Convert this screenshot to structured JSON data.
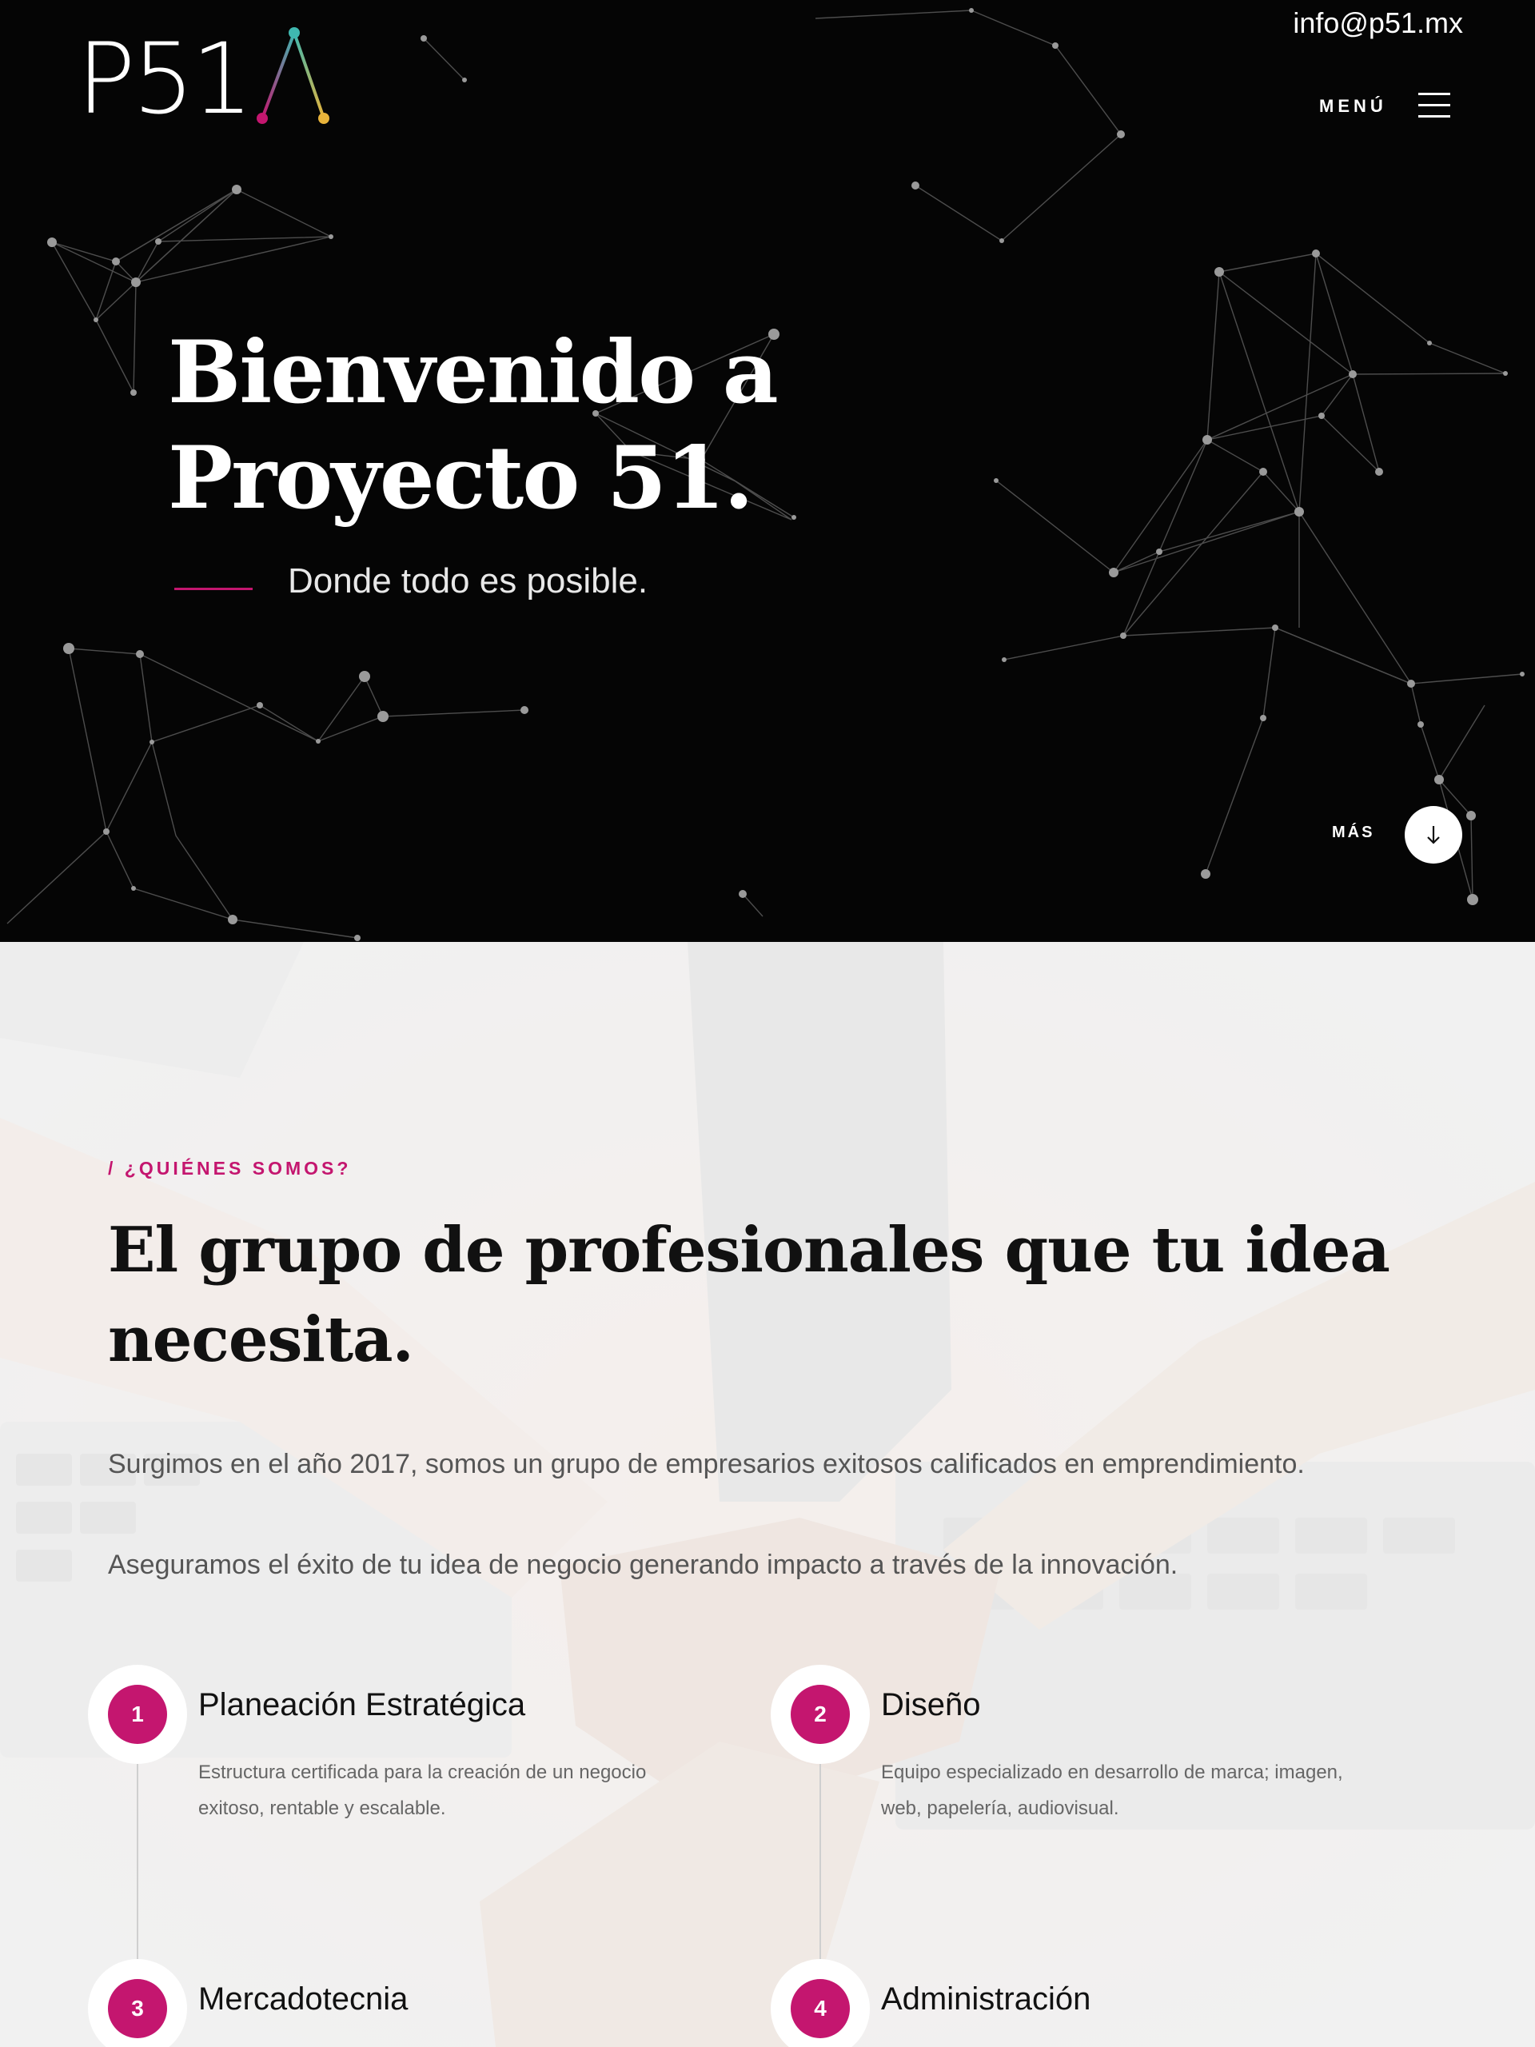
{
  "header": {
    "logo_text": "P51",
    "email": "info@p51.mx",
    "menu_label": "MENÚ",
    "menu_icon": "hamburger-icon"
  },
  "hero": {
    "title": "Bienvenido a Proyecto 51.",
    "subtitle": "Donde todo es posible.",
    "more_label": "MÁS",
    "more_icon": "arrow-down-icon",
    "accent_color": "#c4166f"
  },
  "about": {
    "kicker": "/ ¿QUIÉNES SOMOS?",
    "title": "El grupo de profesionales que tu idea necesita.",
    "paragraph_1": "Surgimos en el año 2017, somos un grupo de empresarios exitosos calificados en emprendimiento.",
    "paragraph_2": "Aseguramos el éxito de tu idea de negocio generando impacto a través de la innovación.",
    "services": [
      {
        "number": "1",
        "title": "Planeación Estratégica",
        "description": "Estructura certificada para la creación de un negocio exitoso, rentable y escalable."
      },
      {
        "number": "2",
        "title": "Diseño",
        "description": "Equipo especializado en desarrollo de marca; imagen, web, papelería, audiovisual."
      },
      {
        "number": "3",
        "title": "Mercadotecnia",
        "description": ""
      },
      {
        "number": "4",
        "title": "Administración",
        "description": ""
      }
    ]
  },
  "colors": {
    "brand_magenta": "#c4166f",
    "hero_background": "#050505",
    "section_background": "#efefef"
  }
}
